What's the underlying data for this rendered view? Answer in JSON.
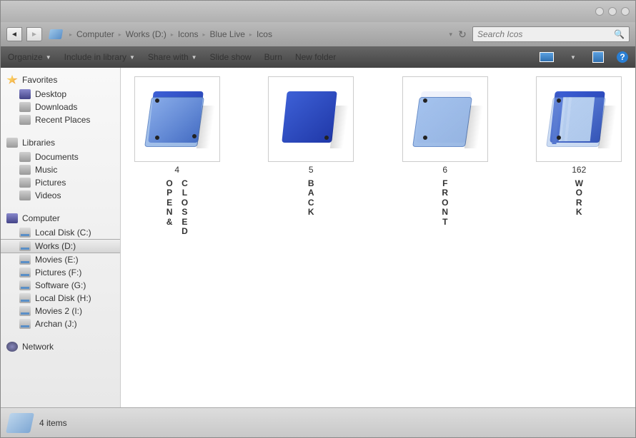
{
  "titlebar": {},
  "breadcrumbs": [
    "Computer",
    "Works (D:)",
    "Icons",
    "Blue Live",
    "Icos"
  ],
  "search": {
    "placeholder": "Search Icos"
  },
  "toolbar": {
    "organize": "Organize",
    "include": "Include in library",
    "share": "Share with",
    "slideshow": "Slide show",
    "burn": "Burn",
    "newfolder": "New folder"
  },
  "sidebar": {
    "favorites": {
      "label": "Favorites",
      "items": [
        "Desktop",
        "Downloads",
        "Recent Places"
      ]
    },
    "libraries": {
      "label": "Libraries",
      "items": [
        "Documents",
        "Music",
        "Pictures",
        "Videos"
      ]
    },
    "computer": {
      "label": "Computer",
      "items": [
        "Local Disk (C:)",
        "Works (D:)",
        "Movies (E:)",
        "Pictures (F:)",
        "Software (G:)",
        "Local Disk (H:)",
        "Movies  2 (I:)",
        "Archan (J:)"
      ],
      "selected": 1
    },
    "network": {
      "label": "Network"
    }
  },
  "files": [
    {
      "num": "4",
      "name": "OPEN & CLOSED",
      "art": "open-closed"
    },
    {
      "num": "5",
      "name": "BACK",
      "art": "back"
    },
    {
      "num": "6",
      "name": "FRONT",
      "art": "front"
    },
    {
      "num": "162",
      "name": "WORK",
      "art": "work"
    }
  ],
  "status": {
    "count": "4 items"
  }
}
